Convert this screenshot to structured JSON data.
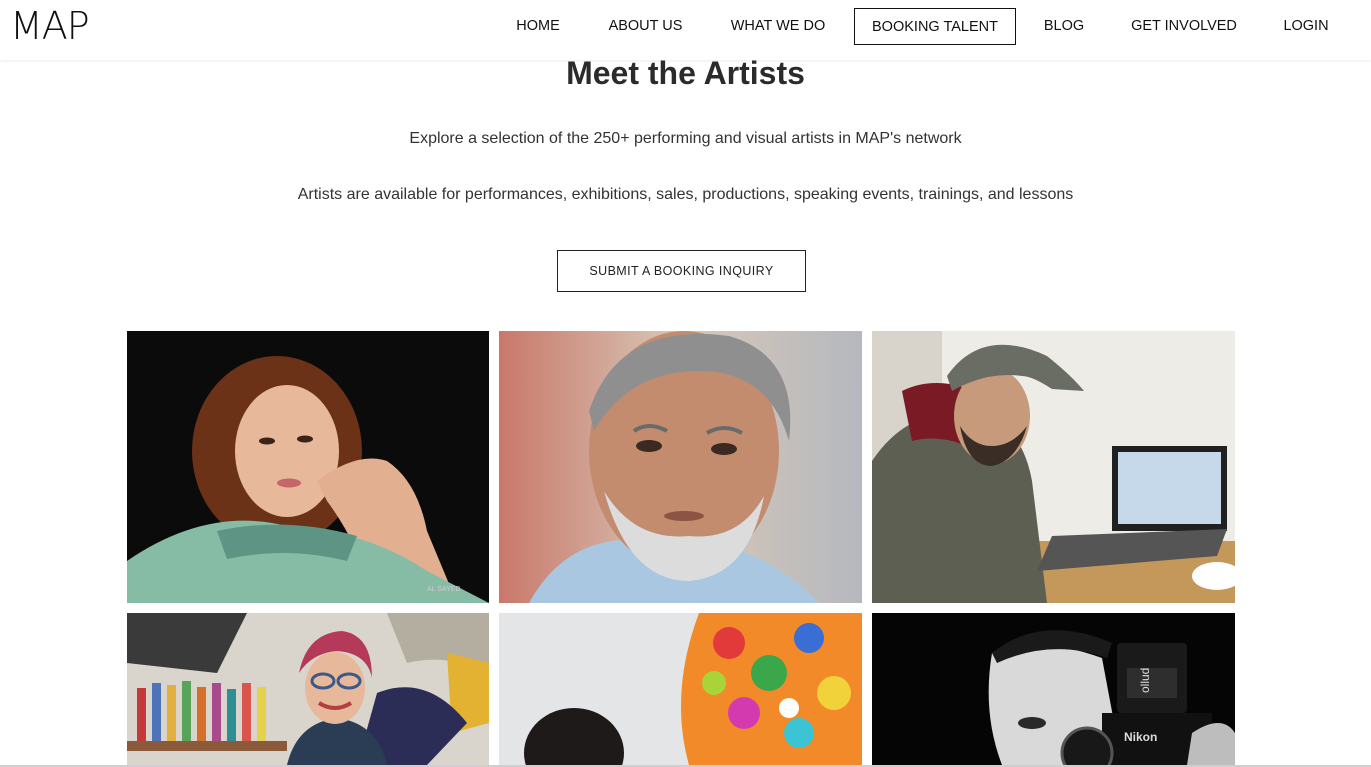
{
  "header": {
    "logo": "MAP",
    "nav": [
      {
        "label": "HOME"
      },
      {
        "label": "ABOUT US"
      },
      {
        "label": "WHAT WE DO"
      },
      {
        "label": "BOOKING TALENT",
        "active": true
      },
      {
        "label": "BLOG"
      },
      {
        "label": "GET INVOLVED"
      },
      {
        "label": "LOGIN"
      }
    ]
  },
  "main": {
    "title": "Meet the Artists",
    "subtitle_1": "Explore a selection of the 250+ performing and visual artists in MAP's network",
    "subtitle_2": "Artists are available for performances, exhibitions, sales, productions, speaking events, trainings, and lessons",
    "cta_label": "SUBMIT A BOOKING INQUIRY",
    "artists": [
      {
        "name": "artist-photo-1",
        "watermark": "AL SAYED"
      },
      {
        "name": "artist-photo-2"
      },
      {
        "name": "artist-photo-3"
      },
      {
        "name": "artist-photo-4"
      },
      {
        "name": "artist-photo-5"
      },
      {
        "name": "artist-photo-6",
        "camera_brand": "Nikon",
        "flash_brand": "ollud"
      }
    ]
  },
  "colors": {
    "text": "#222222",
    "background": "#ffffff",
    "border": "#111111"
  }
}
